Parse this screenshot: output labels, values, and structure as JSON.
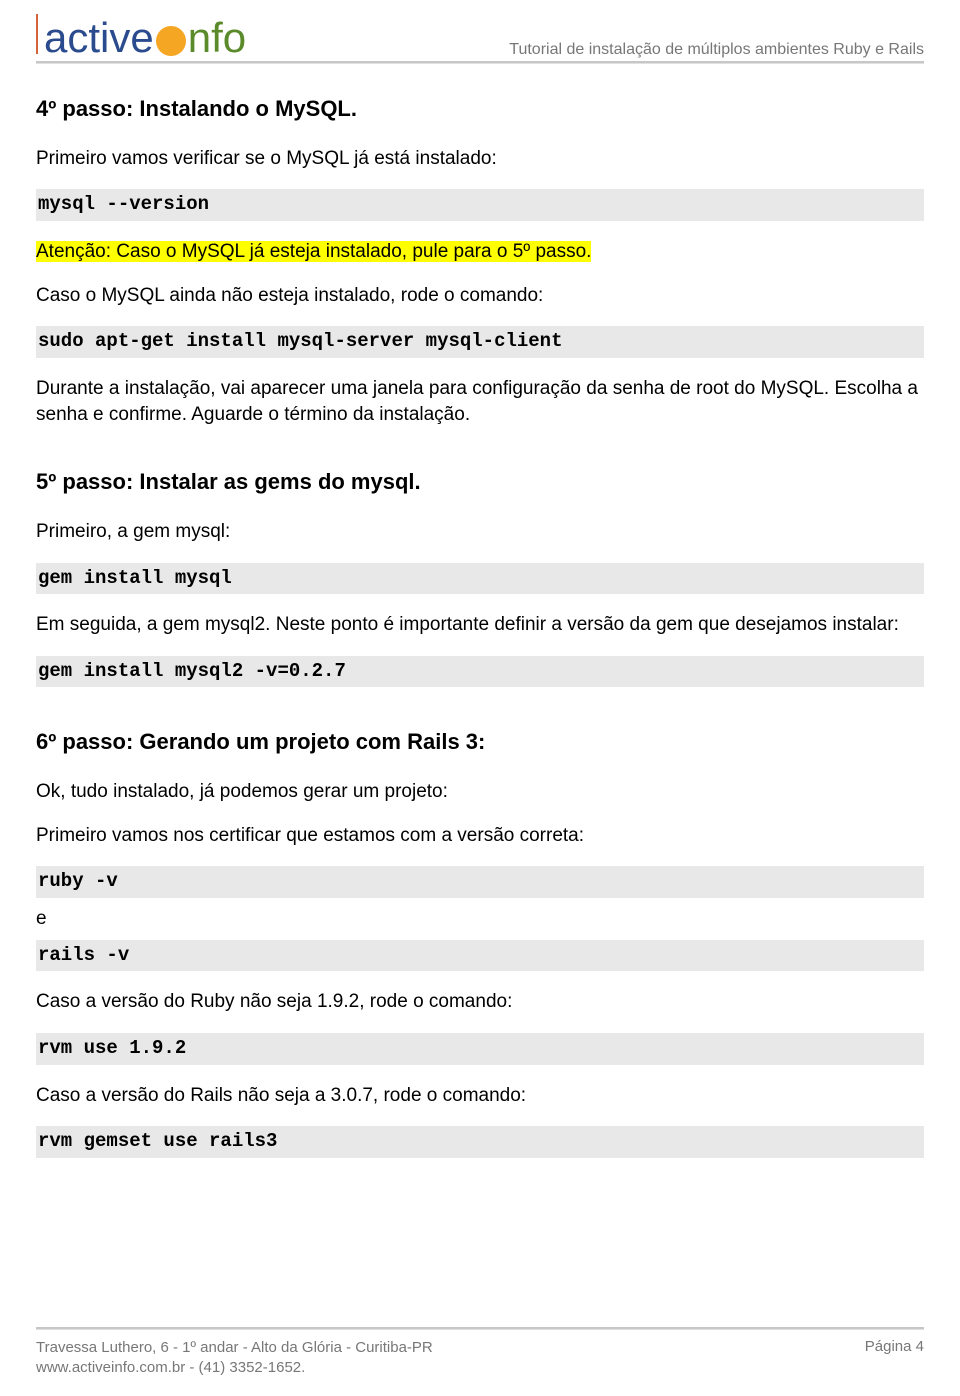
{
  "header": {
    "logo_active": "active",
    "logo_info": "nfo",
    "tutorial_title": "Tutorial de instalação de múltiplos ambientes Ruby e Rails"
  },
  "step4": {
    "title": "4º passo: Instalando o MySQL.",
    "p1": "Primeiro vamos verificar se o MySQL já está instalado:",
    "code1": "mysql --version",
    "highlight": "Atenção: Caso o MySQL já esteja instalado, pule para o 5º passo.",
    "p2": "Caso o MySQL ainda não esteja instalado, rode o comando:",
    "code2": "sudo apt-get install mysql-server mysql-client",
    "p3": "Durante a instalação, vai aparecer uma janela para configuração da senha de root do MySQL. Escolha a senha e confirme. Aguarde o término da instalação."
  },
  "step5": {
    "title": "5º passo: Instalar as gems do mysql.",
    "p1": "Primeiro, a gem mysql:",
    "code1": "gem install mysql",
    "p2": "Em seguida, a gem mysql2. Neste ponto é importante definir a versão da gem que desejamos instalar:",
    "code2": "gem install mysql2 -v=0.2.7"
  },
  "step6": {
    "title": "6º passo: Gerando um projeto com Rails 3:",
    "p1": "Ok, tudo instalado,  já podemos gerar um projeto:",
    "p2": "Primeiro vamos nos certificar que estamos com a versão correta:",
    "code1": "ruby -v",
    "p_e": "e",
    "code2": "rails -v",
    "p3": "Caso a versão do Ruby não seja 1.9.2, rode o comando:",
    "code3": "rvm use 1.9.2",
    "p4": "Caso a versão do Rails não seja a 3.0.7, rode o comando:",
    "code4": "rvm gemset use rails3"
  },
  "footer": {
    "line1": "Travessa Luthero, 6 - 1º andar - Alto da Glória - Curitiba-PR",
    "line2": "www.activeinfo.com.br - (41) 3352-1652.",
    "page": "Página 4"
  }
}
